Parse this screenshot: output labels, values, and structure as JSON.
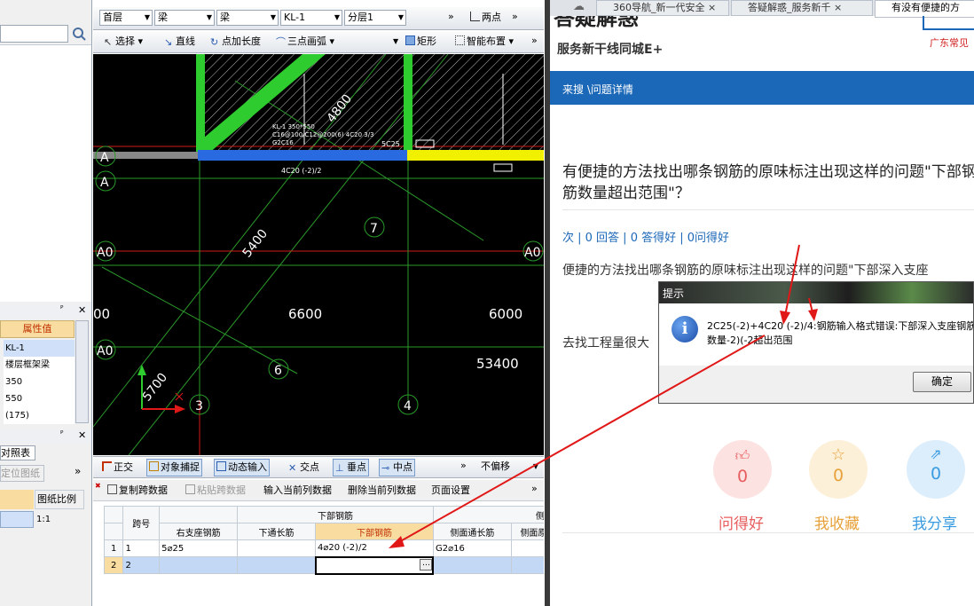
{
  "top_toolbar": {
    "floor": "首层",
    "type1": "梁",
    "type2": "梁",
    "member": "KL-1",
    "layer": "分层1",
    "more": "»",
    "two_point": "两点",
    "more2": "»"
  },
  "draw_toolbar": {
    "select": "选择",
    "line": "直线",
    "point_len": "点加长度",
    "arc": "三点画弧",
    "rect": "矩形",
    "smart": "智能布置",
    "more": "»"
  },
  "left": {
    "prop_header": "属性值",
    "pin": "ᴾ",
    "close": "✕",
    "prop_rows": [
      "KL-1",
      "楼层框架梁",
      "350",
      "550",
      "(175)"
    ],
    "panel2_title": "对照表",
    "locate": "定位图纸",
    "more": "»",
    "scale_header": "图纸比例",
    "scale_value": "1:1"
  },
  "cad": {
    "axis_labels": [
      "A",
      "A",
      "A0",
      "A0",
      "A0"
    ],
    "circle_labels": [
      "7",
      "6",
      "3",
      "4"
    ],
    "dims": [
      "6600",
      "6000",
      "53400",
      "5400",
      "4800",
      "5700",
      "00"
    ],
    "annot": [
      "KL-1 350*550",
      "C16@100/C12@200(6) 4C20 3/3",
      "G2C16",
      "5C25",
      "4C20 (-2)/2"
    ]
  },
  "status_bar": {
    "ortho": "正交",
    "snap": "对象捕捉",
    "dyn": "动态输入",
    "cross": "交点",
    "perp": "垂点",
    "mid": "中点",
    "more": "»",
    "offset": "不偏移"
  },
  "grid_toolbar": {
    "copy": "复制跨数据",
    "paste": "粘贴跨数据",
    "input_col": "输入当前列数据",
    "delete_col": "删除当前列数据",
    "page": "页面设置",
    "more": "»"
  },
  "rebar_table": {
    "group_bottom": "下部钢筋",
    "group_side": "侧面钢",
    "headers": [
      "跨号",
      "右支座钢筋",
      "下通长筋",
      "下部钢筋",
      "侧面通长筋",
      "侧面原位"
    ],
    "rows": [
      [
        "1",
        "1",
        "5⌀25",
        "",
        "4⌀20 (-2)/2",
        "G2⌀16",
        ""
      ],
      [
        "2",
        "2",
        "",
        "",
        "",
        "",
        ""
      ]
    ]
  },
  "browser": {
    "tabs": [
      "360导航_新一代安全",
      "答疑解惑_服务新千",
      "有没有便捷的方"
    ],
    "logo_title": "答疑解惑",
    "logo_sub": "服务新干线同城E+",
    "top_right": "广东常见",
    "breadcrumb": "来搜 \\问题详情",
    "question": "有便捷的方法找出哪条钢筋的原味标注出现这样的问题\"下部钢筋数量超出范围\"？",
    "meta": "次 | 0 回答 | 0 答得好 | 0问得好",
    "body1": "便捷的方法找出哪条钢筋的原味标注出现这样的问题\"下部深入支座",
    "body2": "去找工程量很大",
    "stats": [
      {
        "count": "0",
        "label": "问得好",
        "color": "#e85d5d"
      },
      {
        "count": "0",
        "label": "我收藏",
        "color": "#e8a23c"
      },
      {
        "count": "0",
        "label": "我分享",
        "color": "#3a9be0"
      }
    ]
  },
  "dialog": {
    "title": "提示",
    "message": "2C25(-2)+4C20 (-2)/4:钢筋输入格式错误:下部深入支座钢筋数量-2)(-2超出范围",
    "ok": "确定"
  },
  "colors": {
    "brand_blue": "#1c68b8",
    "cad_bg": "#000000",
    "arrow_red": "#e01818"
  }
}
